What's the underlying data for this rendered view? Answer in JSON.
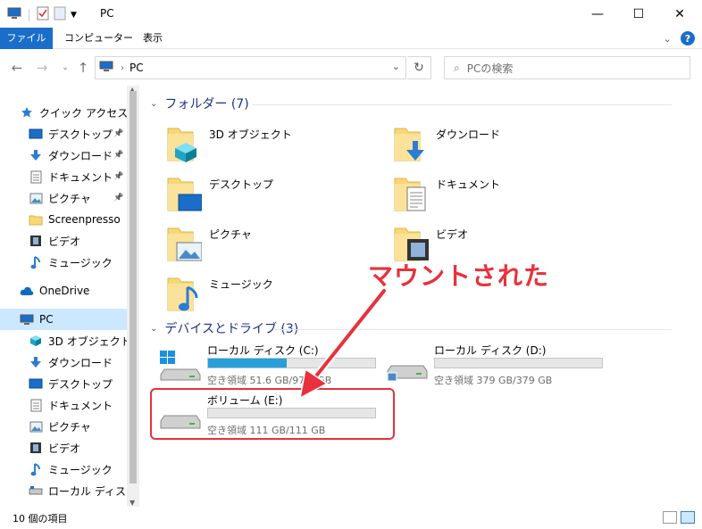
{
  "window": {
    "title": "PC"
  },
  "ribbon": {
    "file": "ファイル",
    "computer": "コンピューター",
    "view": "表示"
  },
  "address": {
    "crumb": "PC"
  },
  "search": {
    "placeholder": "PCの検索"
  },
  "sidebar": {
    "items": [
      {
        "label": "クイック アクセス",
        "icon": "star-icon"
      },
      {
        "label": "デスクトップ",
        "icon": "desktop-icon"
      },
      {
        "label": "ダウンロード",
        "icon": "download-icon"
      },
      {
        "label": "ドキュメント",
        "icon": "document-icon"
      },
      {
        "label": "ピクチャ",
        "icon": "picture-icon"
      },
      {
        "label": "Screenpresso",
        "icon": "folder-icon"
      },
      {
        "label": "ビデオ",
        "icon": "video-icon"
      },
      {
        "label": "ミュージック",
        "icon": "music-icon"
      },
      {
        "label": "OneDrive",
        "icon": "cloud-icon"
      },
      {
        "label": "PC",
        "icon": "pc-icon"
      },
      {
        "label": "3D オブジェクト",
        "icon": "cube-icon"
      },
      {
        "label": "ダウンロード",
        "icon": "download-icon"
      },
      {
        "label": "デスクトップ",
        "icon": "desktop-icon"
      },
      {
        "label": "ドキュメント",
        "icon": "document-icon"
      },
      {
        "label": "ピクチャ",
        "icon": "picture-icon"
      },
      {
        "label": "ビデオ",
        "icon": "video-icon"
      },
      {
        "label": "ミュージック",
        "icon": "music-icon"
      },
      {
        "label": "ローカル ディスク (C",
        "icon": "drive-icon"
      }
    ]
  },
  "groups": {
    "folders": {
      "title": "フォルダー (7)"
    },
    "devices": {
      "title": "デバイスとドライブ (3)"
    }
  },
  "folders": [
    {
      "label": "3D オブジェクト"
    },
    {
      "label": "ダウンロード"
    },
    {
      "label": "デスクトップ"
    },
    {
      "label": "ドキュメント"
    },
    {
      "label": "ピクチャ"
    },
    {
      "label": "ビデオ"
    },
    {
      "label": "ミュージック"
    }
  ],
  "drives": [
    {
      "name": "ローカル ディスク (C:)",
      "free": "空き領域 51.6 GB/97.0 GB",
      "used_fraction": 0.47
    },
    {
      "name": "ローカル ディスク (D:)",
      "free": "空き領域 379 GB/379 GB",
      "used_fraction": 0.0
    },
    {
      "name": "ボリューム (E:)",
      "free": "空き領域 111 GB/111 GB",
      "used_fraction": 0.0
    }
  ],
  "annotation": {
    "text": "マウントされた"
  },
  "status": {
    "count": "10 個の項目"
  },
  "colors": {
    "accent": "#1a6ec9",
    "bar_fill": "#26a0da",
    "annotation": "#e8313c"
  }
}
